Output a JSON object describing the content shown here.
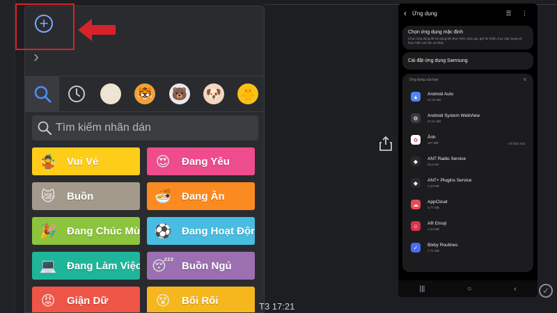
{
  "sticker_panel": {
    "search": {
      "placeholder": "Tìm kiếm nhãn dán"
    },
    "categories": [
      {
        "label": "Vui Vẻ",
        "color": "#fecd1a",
        "emoji": "🤹"
      },
      {
        "label": "Đang Yêu",
        "color": "#ee4c8c",
        "emoji": "😍"
      },
      {
        "label": "Buồn",
        "color": "#a39a8b",
        "emoji": "😿"
      },
      {
        "label": "Đang Ăn",
        "color": "#fb8b20",
        "emoji": "🍜"
      },
      {
        "label": "Đang Chúc Mừng",
        "color": "#8cc43d",
        "emoji": "🎉"
      },
      {
        "label": "Đang Hoạt Động",
        "color": "#47bde2",
        "emoji": "⚽"
      },
      {
        "label": "Đang Làm Việc",
        "color": "#1eb59a",
        "emoji": "💻"
      },
      {
        "label": "Buồn Ngủ",
        "color": "#9b6fb0",
        "emoji": "😴"
      },
      {
        "label": "Giận Dữ",
        "color": "#ef5546",
        "emoji": "😡"
      },
      {
        "label": "Bối Rối",
        "color": "#f6b61e",
        "emoji": "😵"
      }
    ],
    "accent_color": "#7ea6ff"
  },
  "chat": {
    "timestamp": "T3 17:21"
  },
  "phone": {
    "header_title": "Ứng dụng",
    "card1_title": "Chọn ứng dụng mặc định",
    "card1_sub": "Chọn ứng dụng để sử dụng khi thực hiện cuộc gọi, gửi tin nhắn, truy cập mạng và thực hiện các tác vụ khác.",
    "card2_title": "Cài đặt ứng dụng Samsung",
    "list_header": "Ứng dụng của bạn",
    "apps": [
      {
        "name": "Android Auto",
        "size": "57,23 MB",
        "color": "#4e86f7",
        "icon": "▲"
      },
      {
        "name": "Android System WebView",
        "size": "97,61 MB",
        "color": "#3b3b3f",
        "icon": "⚙"
      },
      {
        "name": "Ảnh",
        "size": "107 MB",
        "color": "#ffffff",
        "icon": "✿",
        "extra": "Vô hiệu hóa"
      },
      {
        "name": "ANT Radio Service",
        "size": "52,6 KB",
        "color": "#2a2a2d",
        "icon": "◆"
      },
      {
        "name": "ANT+ Plugins Service",
        "size": "2,23 MB",
        "color": "#2a2a2d",
        "icon": "◆"
      },
      {
        "name": "AppCloud",
        "size": "5,77 MB",
        "color": "#e94b55",
        "icon": "☁"
      },
      {
        "name": "AR Emoji",
        "size": "1,23 MB",
        "color": "#d8344a",
        "icon": "☺"
      },
      {
        "name": "Bixby Routines",
        "size": "7,71 MB",
        "color": "#4a6cf7",
        "icon": "✓"
      }
    ]
  },
  "colors": {
    "highlight": "#d6232a"
  }
}
